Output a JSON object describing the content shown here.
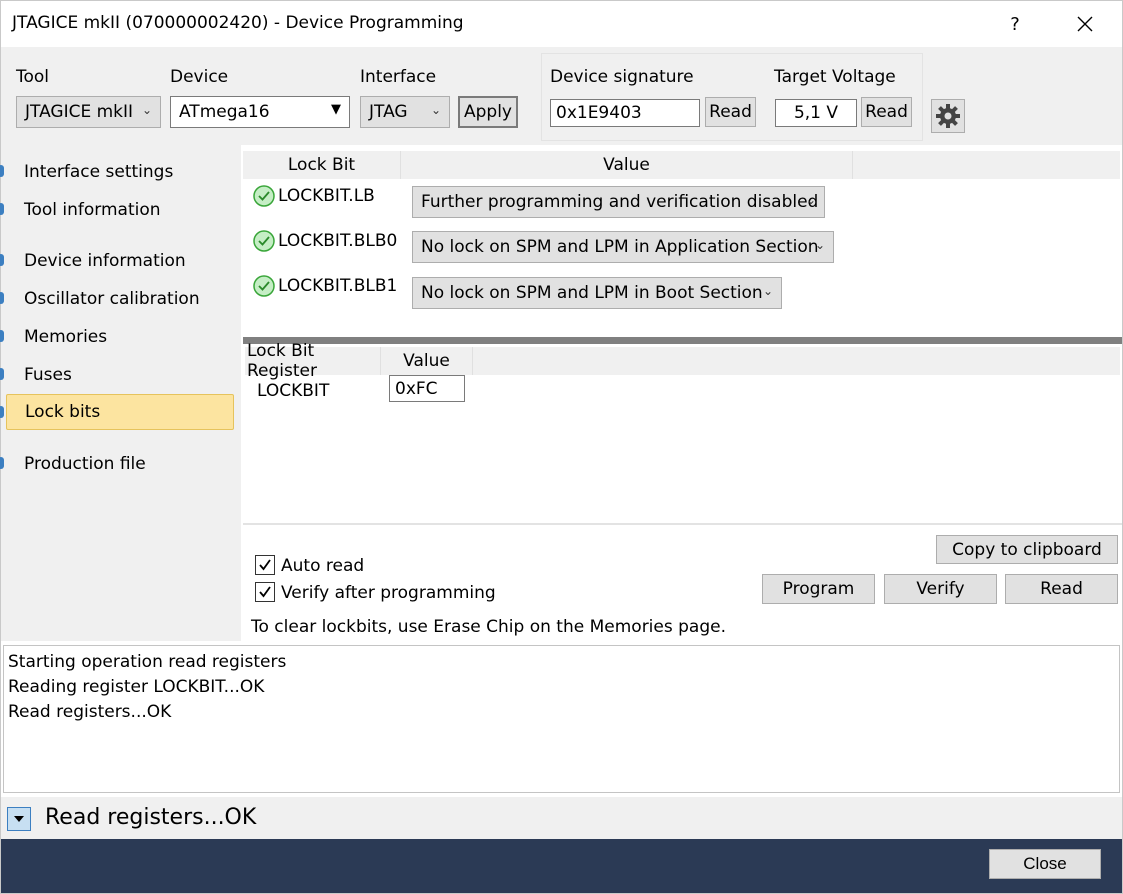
{
  "window": {
    "title": "JTAGICE mkII (070000002420) - Device Programming",
    "help": "?",
    "close": "✕"
  },
  "toolbar": {
    "tool_label": "Tool",
    "tool_value": "JTAGICE mkII",
    "device_label": "Device",
    "device_value": "ATmega16",
    "interface_label": "Interface",
    "interface_value": "JTAG",
    "apply": "Apply",
    "signature_label": "Device signature",
    "signature_value": "0x1E9403",
    "signature_read": "Read",
    "voltage_label": "Target Voltage",
    "voltage_value": "5,1 V",
    "voltage_read": "Read",
    "settings_icon": "gear-icon"
  },
  "sidebar": {
    "items": [
      {
        "label": "Interface settings"
      },
      {
        "label": "Tool information"
      },
      {
        "label": "Device information"
      },
      {
        "label": "Oscillator calibration"
      },
      {
        "label": "Memories"
      },
      {
        "label": "Fuses"
      },
      {
        "label": "Lock bits"
      },
      {
        "label": "Production file"
      }
    ],
    "selected": "Lock bits"
  },
  "lockbits": {
    "col_lockbit": "Lock Bit",
    "col_value": "Value",
    "rows": [
      {
        "name": "LOCKBIT.LB",
        "value": "Further programming and verification disabled"
      },
      {
        "name": "LOCKBIT.BLB0",
        "value": "No lock on SPM and LPM in Application Section"
      },
      {
        "name": "LOCKBIT.BLB1",
        "value": "No lock on SPM and LPM in Boot Section"
      }
    ],
    "status_icon": "check-circle-icon",
    "status_color": "#3aa63a"
  },
  "register": {
    "col_register": "Lock Bit Register",
    "col_value": "Value",
    "name": "LOCKBIT",
    "value": "0xFC"
  },
  "actions": {
    "auto_read": "Auto read",
    "auto_read_checked": true,
    "verify_after": "Verify after programming",
    "verify_after_checked": true,
    "copy": "Copy to clipboard",
    "program": "Program",
    "verify": "Verify",
    "read": "Read",
    "hint": "To clear lockbits, use Erase Chip on the Memories page."
  },
  "log": {
    "lines": [
      "Starting operation read registers",
      "Reading register LOCKBIT...OK",
      "Read registers...OK"
    ]
  },
  "status": {
    "text": "Read registers...OK",
    "expander_icon": "chevron-down-icon"
  },
  "footer": {
    "close": "Close",
    "background": "#2b3a55"
  }
}
